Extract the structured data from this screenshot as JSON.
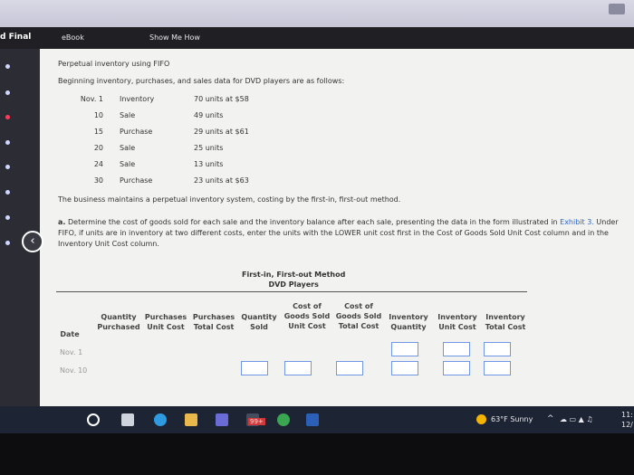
{
  "tabs": {
    "active": "d Final",
    "ebook": "eBook",
    "show_me_how": "Show Me How"
  },
  "title": "Perpetual inventory using FIFO",
  "intro": "Beginning inventory, purchases, and sales data for DVD players are as follows:",
  "transactions": [
    {
      "date": "Nov. 1",
      "type": "Inventory",
      "qty": "70 units at $58"
    },
    {
      "date": "10",
      "type": "Sale",
      "qty": "49 units"
    },
    {
      "date": "15",
      "type": "Purchase",
      "qty": "29 units at $61"
    },
    {
      "date": "20",
      "type": "Sale",
      "qty": "25 units"
    },
    {
      "date": "24",
      "type": "Sale",
      "qty": "13 units"
    },
    {
      "date": "30",
      "type": "Purchase",
      "qty": "23 units at $63"
    }
  ],
  "method_text": "The business maintains a perpetual inventory system, costing by the first-in, first-out method.",
  "requirement": {
    "prefix": "a.",
    "text": "Determine the cost of goods sold for each sale and the inventory balance after each sale, presenting the data in the form illustrated in",
    "link": "Exhibit 3.",
    "note": "Under FIFO, if units are in inventory at two different costs, enter the units with the LOWER unit cost first in the Cost of Goods Sold Unit Cost column and in the Inventory Unit Cost column."
  },
  "table_heading": {
    "line1": "First-in, First-out Method",
    "line2": "DVD Players"
  },
  "columns": {
    "date": "Date",
    "q_purchased": "Quantity Purchased",
    "p_unit": "Purchases Unit Cost",
    "p_total": "Purchases Total Cost",
    "q_sold": "Quantity Sold",
    "cogs_unit": "Cost of Goods Sold Unit Cost",
    "cogs_total": "Cost of Goods Sold Total Cost",
    "inv_qty": "Inventory Quantity",
    "inv_unit": "Inventory Unit Cost",
    "inv_total": "Inventory Total Cost"
  },
  "table_rows": [
    {
      "date": "Nov. 1"
    },
    {
      "date": "Nov. 10"
    }
  ],
  "taskbar": {
    "weather": "63°F  Sunny",
    "time": "11:",
    "date": "12/",
    "badge": "99+"
  }
}
